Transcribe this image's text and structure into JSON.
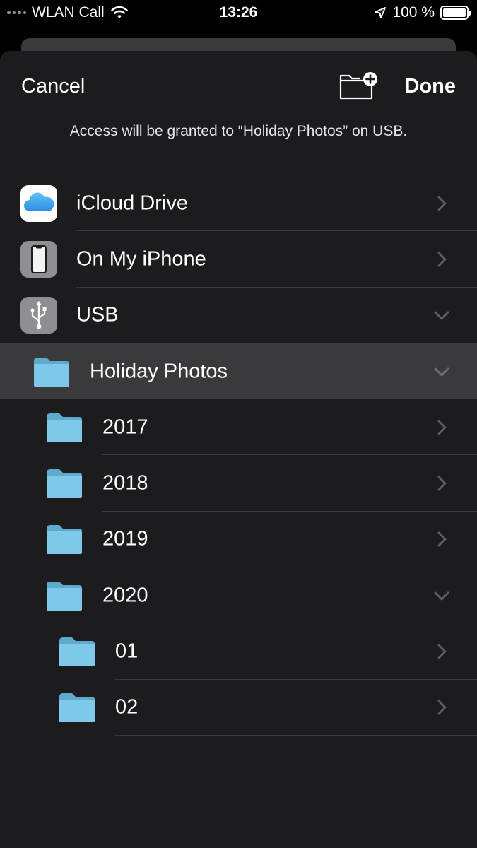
{
  "status_bar": {
    "carrier": "WLAN Call",
    "time": "13:26",
    "battery": "100 %",
    "battery_level": 1.0
  },
  "sheet": {
    "cancel_label": "Cancel",
    "done_label": "Done",
    "info_text": "Access will be granted to “Holiday Photos” on USB."
  },
  "locations": [
    {
      "label": "iCloud Drive",
      "icon": "icloud-icon",
      "expanded": false
    },
    {
      "label": "On My iPhone",
      "icon": "iphone-icon",
      "expanded": false
    },
    {
      "label": "USB",
      "icon": "usb-icon",
      "expanded": true
    }
  ],
  "folders": [
    {
      "label": "Holiday Photos",
      "level": 1,
      "expanded": true,
      "selected": true
    },
    {
      "label": "2017",
      "level": 2,
      "expanded": false
    },
    {
      "label": "2018",
      "level": 2,
      "expanded": false
    },
    {
      "label": "2019",
      "level": 2,
      "expanded": false
    },
    {
      "label": "2020",
      "level": 2,
      "expanded": true
    },
    {
      "label": "01",
      "level": 3,
      "expanded": false
    },
    {
      "label": "02",
      "level": 3,
      "expanded": false
    }
  ],
  "colors": {
    "sheet_bg": "#1c1c1e",
    "selected_row": "#3a3a3c",
    "folder_blue": "#7ec8ea",
    "chevron": "#5e5e63"
  }
}
